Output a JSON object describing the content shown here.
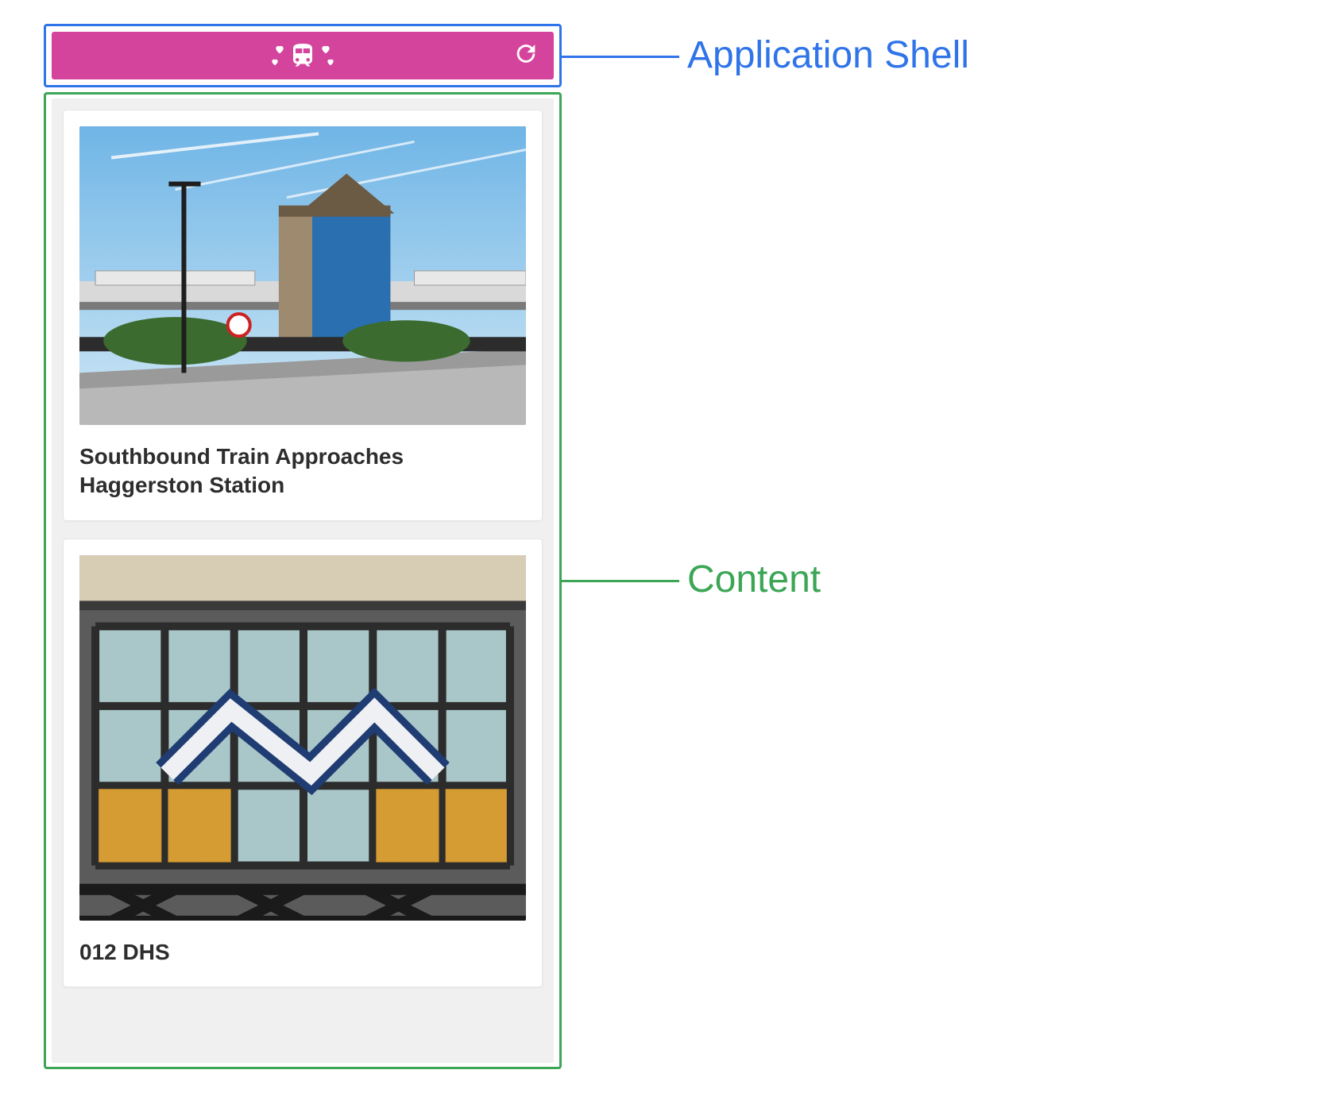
{
  "labels": {
    "shell": "Application Shell",
    "content": "Content"
  },
  "cards": [
    {
      "title": "Southbound Train Approaches Haggerston Station"
    },
    {
      "title": "012 DHS"
    }
  ],
  "colors": {
    "shell_outline": "#2F74E8",
    "content_outline": "#3CA656",
    "shell_bg": "#D4449D"
  },
  "icons": {
    "logo": "train-hearts-icon",
    "action": "refresh-icon"
  }
}
